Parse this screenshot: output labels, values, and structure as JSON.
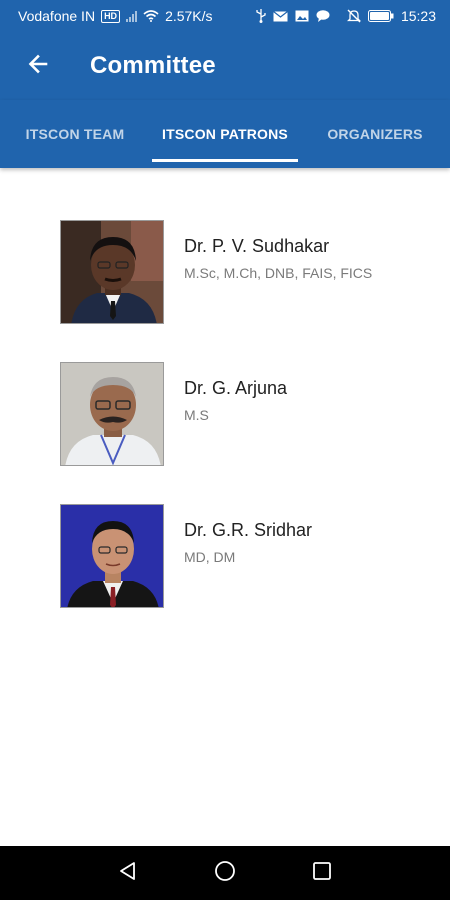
{
  "status_bar": {
    "carrier": "Vodafone IN",
    "carrier_badge": "HD",
    "speed": "2.57K/s",
    "time": "15:23",
    "icons": [
      "signal-icon",
      "wifi-icon",
      "usb-icon",
      "mail-icon",
      "image-icon",
      "chat-icon",
      "mute-icon",
      "battery-icon"
    ]
  },
  "app_bar": {
    "title": "Committee",
    "back_icon": "arrow-left-icon"
  },
  "tabs": [
    {
      "label": "ITSCON TEAM",
      "active": false
    },
    {
      "label": "ITSCON PATRONS",
      "active": true
    },
    {
      "label": "ORGANIZERS",
      "active": false
    }
  ],
  "patrons": [
    {
      "name": "Dr. P. V. Sudhakar",
      "qualifications": "M.Sc, M.Ch, DNB, FAIS, FICS"
    },
    {
      "name": "Dr. G. Arjuna",
      "qualifications": "M.S"
    },
    {
      "name": "Dr. G.R. Sridhar",
      "qualifications": "MD, DM"
    }
  ],
  "colors": {
    "primary": "#2064ad",
    "tab_indicator": "#ffffff",
    "name_text": "#222222",
    "qual_text": "#7a7a7a",
    "nav_bar": "#000000"
  },
  "nav_bar": {
    "icons": [
      "back-triangle-icon",
      "home-circle-icon",
      "recents-square-icon"
    ]
  }
}
